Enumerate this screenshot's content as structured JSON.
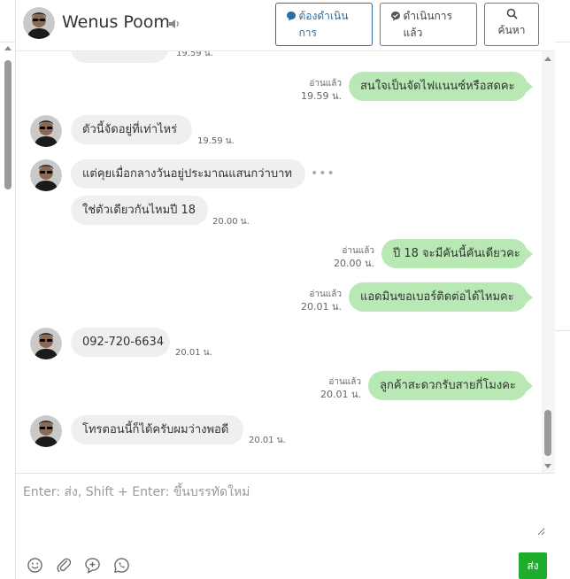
{
  "header": {
    "contact_name": "Wenus Poom",
    "btn_todo": "ต้องดำเนินการ",
    "btn_done": "ดำเนินการแล้ว",
    "btn_search": "ค้นหา"
  },
  "messages": [
    {
      "side": "out",
      "text": "สนใจเป็นจัดไฟแนนซ์หรือสดคะ",
      "read_label": "อ่านแล้ว",
      "time": "19.59 น."
    },
    {
      "side": "in",
      "text": "ตัวนี้จัดอยู่ที่เท่าไหร่",
      "time": "19.59 น."
    },
    {
      "side": "in",
      "text": "แต่คุยเมื่อกลางวันอยู่ประมาณแสนกว่าบาท",
      "more": "•••"
    },
    {
      "side": "in",
      "text": "ใช่ตัวเดียวกันไหมปี 18",
      "time": "20.00 น."
    },
    {
      "side": "out",
      "text": "ปี 18 จะมีคันนี้คันเดียวคะ",
      "read_label": "อ่านแล้ว",
      "time": "20.00 น."
    },
    {
      "side": "out",
      "text": "แอดมินขอเบอร์ติดต่อได้ไหมคะ",
      "read_label": "อ่านแล้ว",
      "time": "20.01 น."
    },
    {
      "side": "in",
      "text": "092-720-6634",
      "time": "20.01 น."
    },
    {
      "side": "out",
      "text": "ลูกค้าสะดวกรับสายกี่โมงคะ",
      "read_label": "อ่านแล้ว",
      "time": "20.01 น."
    },
    {
      "side": "in",
      "text": "โทรตอนนี้ก็ได้ครับผมว่างพอดี",
      "time": "20.01 น."
    }
  ],
  "top_partial_time": "19.59 น.",
  "composer": {
    "placeholder": "Enter: ส่ง, Shift + Enter: ขึ้นบรรทัดใหม่",
    "send_label": "ส่ง"
  },
  "colors": {
    "outgoing_bubble": "#b8e8b4",
    "incoming_bubble": "#efefef",
    "send_button": "#1fad2e",
    "primary_button": "#2d6da3"
  }
}
